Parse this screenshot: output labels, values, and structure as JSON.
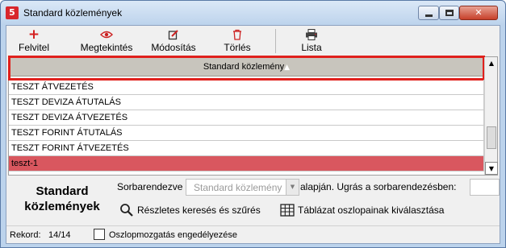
{
  "window": {
    "title": "Standard közlemények"
  },
  "toolbar": {
    "add": {
      "label": "Felvitel",
      "icon": "plus-icon"
    },
    "view": {
      "label": "Megtekintés",
      "icon": "eye-icon"
    },
    "edit": {
      "label": "Módosítás",
      "icon": "edit-icon"
    },
    "delete": {
      "label": "Törlés",
      "icon": "trash-icon"
    },
    "list": {
      "label": "Lista",
      "icon": "printer-icon"
    }
  },
  "grid": {
    "column_header": "Standard közlemény",
    "sort_indicator": "▲",
    "rows": [
      "TESZT ÁTVEZETÉS",
      "TESZT DEVIZA ÁTUTALÁS",
      "TESZT DEVIZA ÁTVEZETÉS",
      "TESZT FORINT ÁTUTALÁS",
      "TESZT FORINT ÁTVEZETÉS",
      "teszt-1"
    ],
    "selected_row": "teszt-1"
  },
  "bottom": {
    "title_line1": "Standard",
    "title_line2": "közlemények",
    "sort_label": "Sorbarendezve",
    "sort_value": "Standard közlemény",
    "after_label": "alapján. Ugrás a sorbarendezésben:",
    "search_label": "Részletes keresés és szűrés",
    "table_label": "Táblázat oszlopainak kiválasztása"
  },
  "status": {
    "record_label": "Rekord:",
    "record_value": "14/14",
    "checkbox_label": "Oszlopmozgatás engedélyezése"
  },
  "colors": {
    "accent_red": "#e0201c",
    "selected_row": "#d9575f",
    "header_bg": "#c8c5bd"
  }
}
